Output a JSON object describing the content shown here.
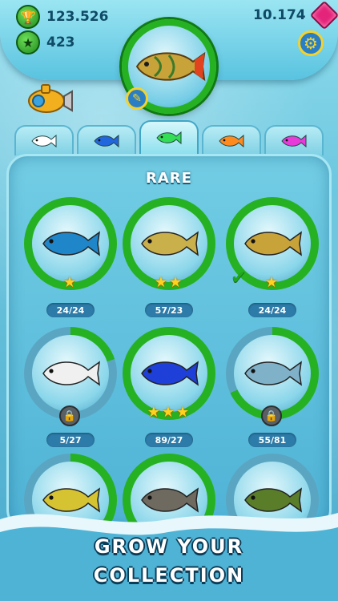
{
  "header": {
    "trophies": "123.526",
    "stars": "423",
    "gems": "10.174"
  },
  "tabs": [
    {
      "name": "tab-white-fish",
      "color": "#ffffff"
    },
    {
      "name": "tab-blue-fish",
      "color": "#2266dd"
    },
    {
      "name": "tab-green-fish",
      "color": "#33dd55",
      "active": true
    },
    {
      "name": "tab-orange-fish",
      "color": "#ff8a1e"
    },
    {
      "name": "tab-pink-fish",
      "color": "#e63bd9"
    }
  ],
  "panel": {
    "title": "RARE"
  },
  "fish": [
    {
      "name": "discus",
      "count": "24/24",
      "stars": "★",
      "progress": 1.0,
      "locked": false,
      "checked": false
    },
    {
      "name": "pufferfish",
      "count": "57/23",
      "stars": "★★",
      "progress": 1.0,
      "locked": false,
      "checked": false
    },
    {
      "name": "cichlid",
      "count": "24/24",
      "stars": "★",
      "progress": 1.0,
      "locked": false,
      "checked": true
    },
    {
      "name": "moorish-idol",
      "count": "5/27",
      "stars": "",
      "progress": 0.2,
      "locked": true,
      "checked": false
    },
    {
      "name": "blue-tang",
      "count": "89/27",
      "stars": "★★★",
      "progress": 1.0,
      "locked": false,
      "checked": false
    },
    {
      "name": "dolphin",
      "count": "55/81",
      "stars": "",
      "progress": 0.68,
      "locked": true,
      "checked": false
    },
    {
      "name": "mahi-mahi",
      "count": "",
      "stars": "",
      "progress": 0.55,
      "locked": false,
      "checked": false
    },
    {
      "name": "grouper",
      "count": "",
      "stars": "",
      "progress": 1.0,
      "locked": false,
      "checked": false
    },
    {
      "name": "moray-eel",
      "count": "",
      "stars": "",
      "progress": 0.0,
      "locked": false,
      "checked": false
    }
  ],
  "promo": {
    "line1": "GROW YOUR",
    "line2": "COLLECTION"
  },
  "colors": {
    "ring_green": "#26b122",
    "ring_track": "#5aa6c2",
    "accent_yellow": "#f4d22e"
  }
}
